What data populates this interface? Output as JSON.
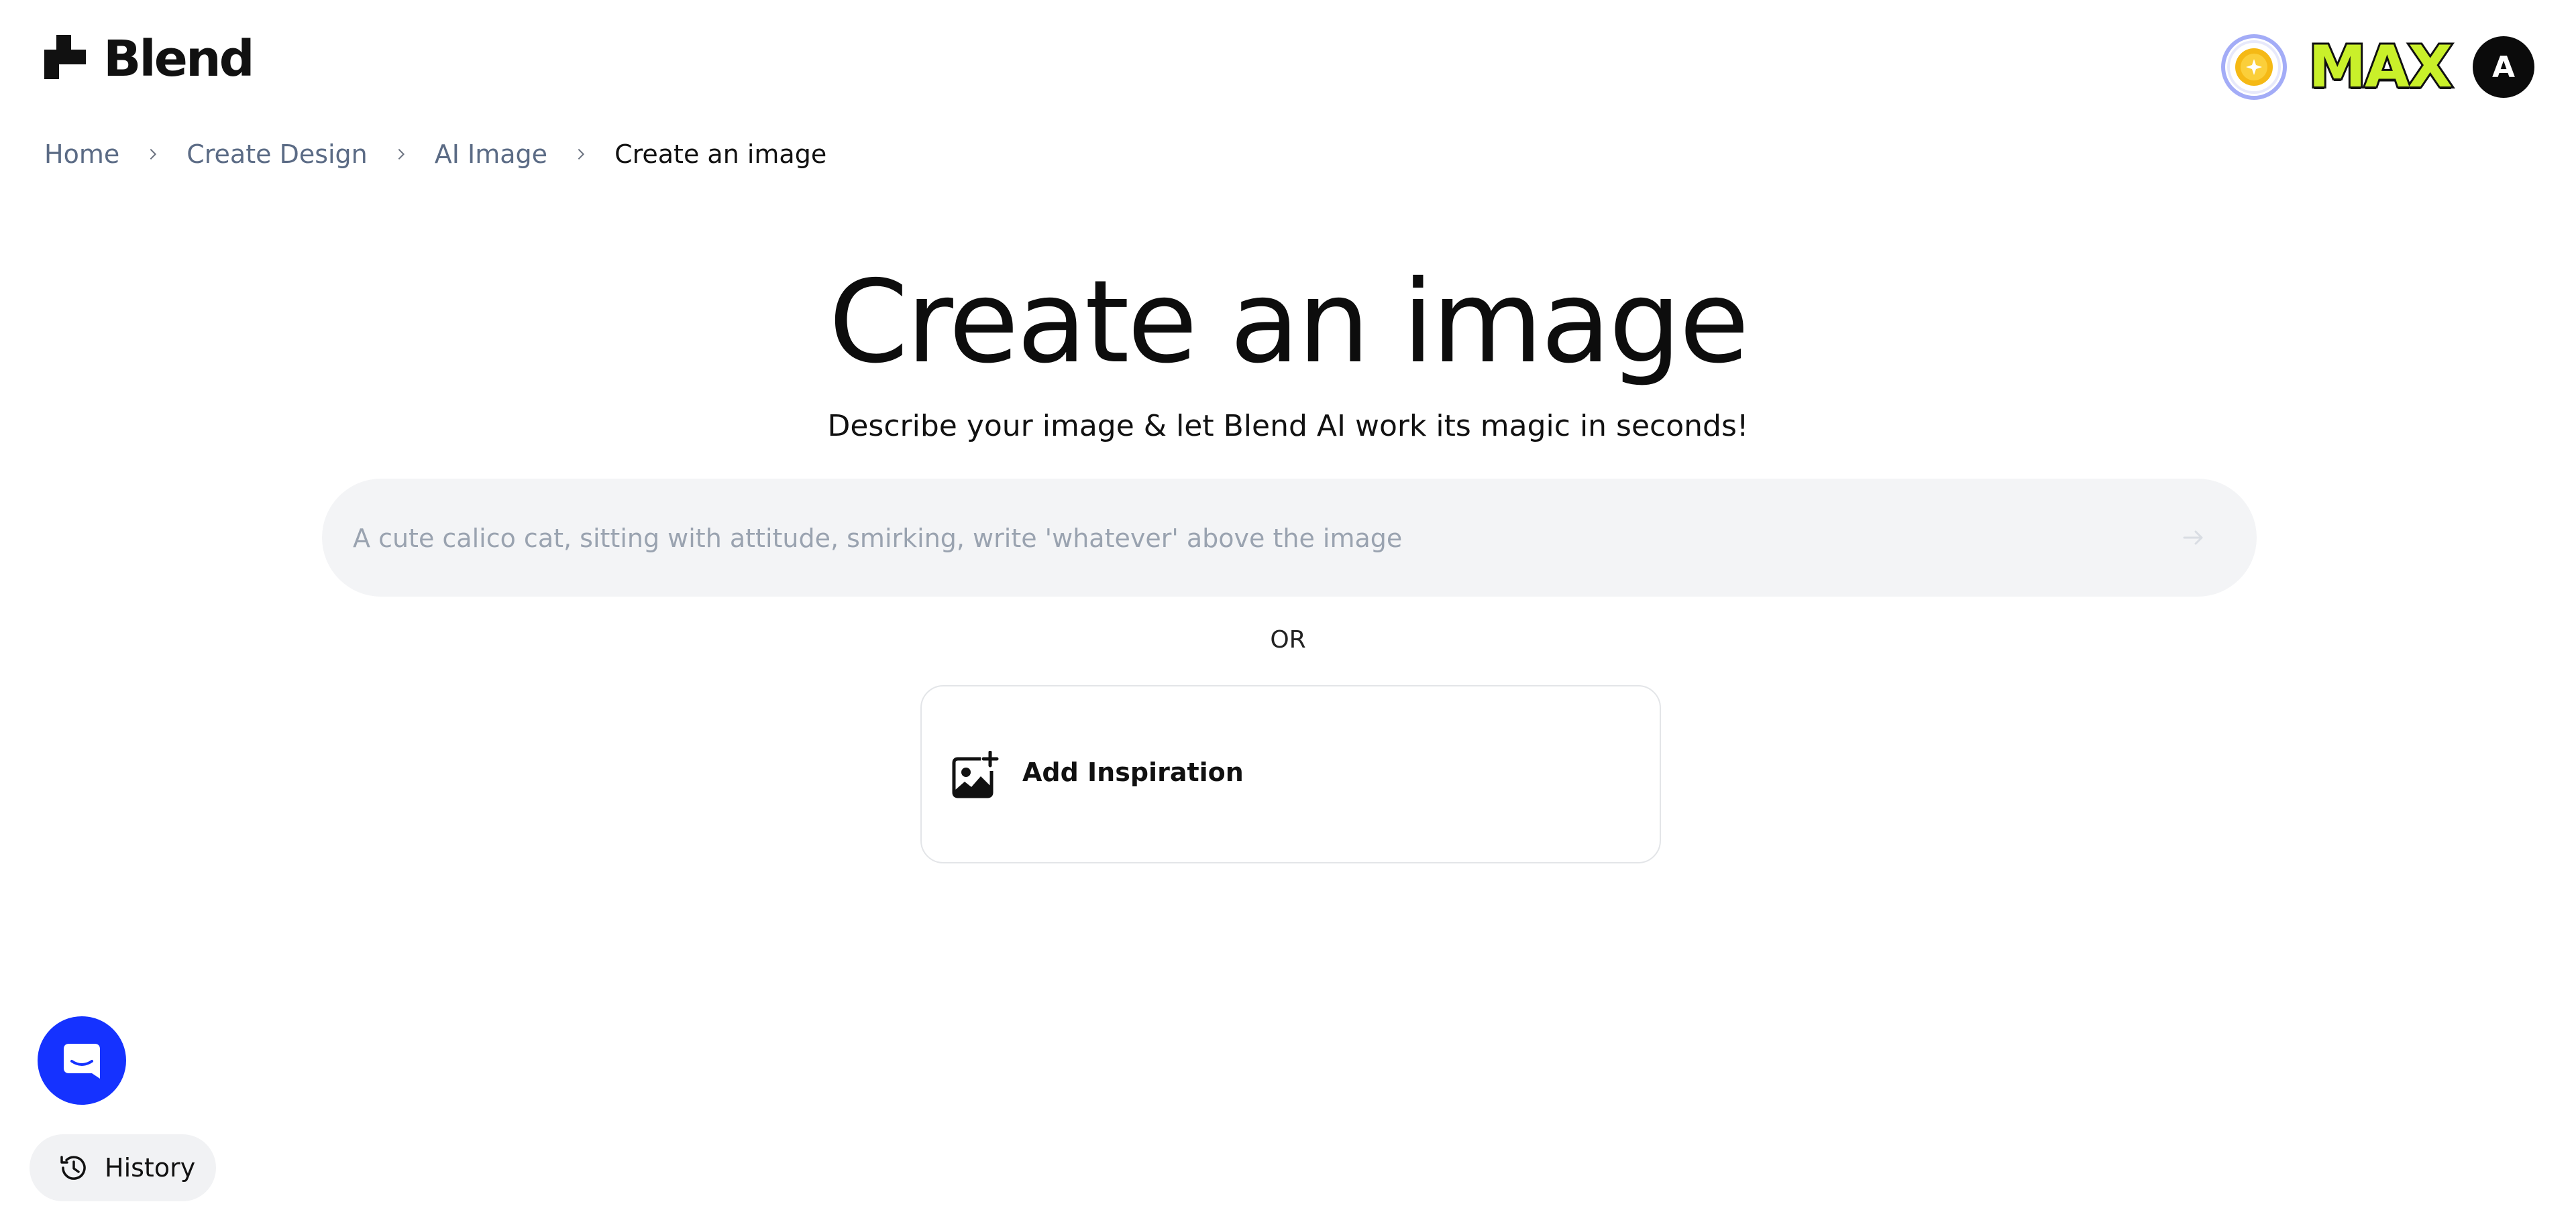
{
  "brand": {
    "name": "Blend",
    "logo_icon": "blend-logo-icon"
  },
  "header": {
    "coin_icon": "coin-icon",
    "plan_badge": "MAX",
    "avatar_initial": "A"
  },
  "breadcrumb": {
    "items": [
      "Home",
      "Create Design",
      "AI Image",
      "Create an image"
    ]
  },
  "hero": {
    "title": "Create an image",
    "subtitle": "Describe your image & let Blend AI work its magic in seconds!"
  },
  "prompt": {
    "placeholder": "A cute calico cat, sitting with attitude, smirking, write 'whatever' above the image",
    "value": "",
    "send_icon": "arrow-right-icon"
  },
  "divider_text": "OR",
  "inspiration": {
    "label": "Add Inspiration",
    "icon": "image-add-icon"
  },
  "chat": {
    "icon": "chat-bubble-icon"
  },
  "history": {
    "label": "History",
    "icon": "history-icon"
  },
  "colors": {
    "accent_blue": "#1532ff",
    "max_badge": "#c9f02a",
    "input_bg": "#f3f4f6",
    "breadcrumb_link": "#5b6b85"
  }
}
